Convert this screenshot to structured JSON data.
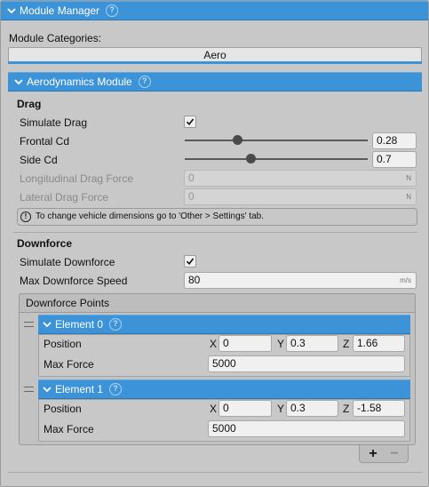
{
  "header": {
    "title": "Module Manager",
    "help_icon": "help-icon"
  },
  "categories": {
    "label": "Module Categories:",
    "selected": "Aero"
  },
  "module": {
    "title": "Aerodynamics Module"
  },
  "drag": {
    "section_title": "Drag",
    "simulate_label": "Simulate Drag",
    "simulate_checked": true,
    "frontal_label": "Frontal Cd",
    "frontal_value": "0.28",
    "frontal_slider_fraction": 0.29,
    "side_label": "Side Cd",
    "side_value": "0.7",
    "side_slider_fraction": 0.36,
    "longitudinal_label": "Longitudinal Drag Force",
    "longitudinal_value": "0",
    "longitudinal_unit": "N",
    "lateral_label": "Lateral Drag Force",
    "lateral_value": "0",
    "lateral_unit": "N",
    "info_text": "To change vehicle dimensions go to 'Other > Settings' tab."
  },
  "downforce": {
    "section_title": "Downforce",
    "simulate_label": "Simulate Downforce",
    "simulate_checked": true,
    "max_speed_label": "Max Downforce Speed",
    "max_speed_value": "80",
    "max_speed_unit": "m/s",
    "points_title": "Downforce Points",
    "elements": [
      {
        "title": "Element 0",
        "position_label": "Position",
        "x_label": "X",
        "x": "0",
        "y_label": "Y",
        "y": "0.3",
        "z_label": "Z",
        "z": "1.66",
        "max_force_label": "Max Force",
        "max_force": "5000"
      },
      {
        "title": "Element 1",
        "position_label": "Position",
        "x_label": "X",
        "x": "0",
        "y_label": "Y",
        "y": "0.3",
        "z_label": "Z",
        "z": "-1.58",
        "max_force_label": "Max Force",
        "max_force": "5000"
      }
    ],
    "add_label": "+",
    "remove_label": "−"
  },
  "colors": {
    "accent": "#3d93d8",
    "panel": "#c8c8c8"
  }
}
